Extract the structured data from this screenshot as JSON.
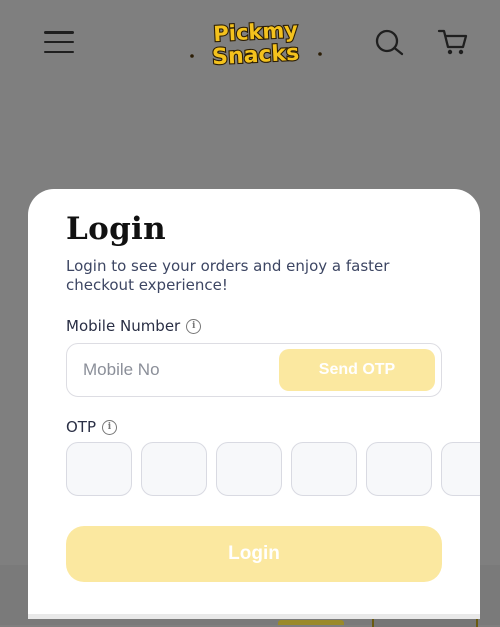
{
  "header": {
    "menu_icon": "hamburger-menu-icon",
    "logo_text_1": "Pickmy",
    "logo_text_2": "Snacks",
    "search_icon": "search-icon",
    "cart_icon": "cart-icon"
  },
  "login": {
    "title": "Login",
    "subtitle": "Login to see your orders and enjoy a faster checkout experience!",
    "mobile_label": "Mobile Number",
    "mobile_placeholder": "Mobile No",
    "send_otp_label": "Send OTP",
    "otp_label": "OTP",
    "info_icon": "info-icon",
    "otp_box_count": 6,
    "login_label": "Login"
  },
  "colors": {
    "overlay": "#7f7f7f",
    "accent_disabled": "#fbe8a0",
    "logo_yellow": "#f4c21d",
    "logo_outline": "#2b1d05"
  }
}
